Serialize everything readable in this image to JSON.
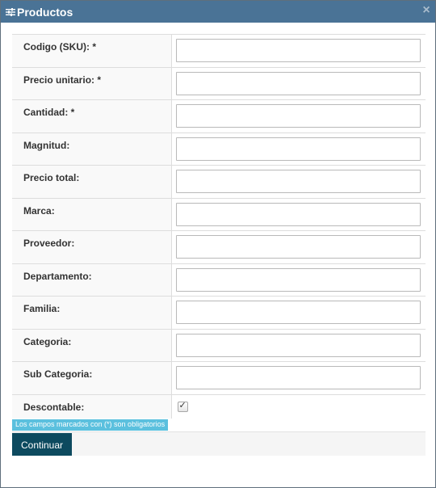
{
  "dialog": {
    "title": "Productos",
    "title_icon": "sliders-icon",
    "close_icon": "close-icon",
    "close_glyph": "×"
  },
  "form": {
    "fields": [
      {
        "label": "Codigo (SKU): *",
        "value": "",
        "required": true
      },
      {
        "label": "Precio unitario: *",
        "value": "",
        "required": true
      },
      {
        "label": "Cantidad: *",
        "value": "",
        "required": true
      },
      {
        "label": "Magnitud:",
        "value": ""
      },
      {
        "label": "Precio total:",
        "value": ""
      },
      {
        "label": "Marca:",
        "value": ""
      },
      {
        "label": "Proveedor:",
        "value": ""
      },
      {
        "label": "Departamento:",
        "value": ""
      },
      {
        "label": "Familia:",
        "value": ""
      },
      {
        "label": "Categoria:",
        "value": ""
      },
      {
        "label": "Sub Categoria:",
        "value": ""
      }
    ],
    "descontable": {
      "label": "Descontable:",
      "checked": true,
      "check_glyph": "✓"
    }
  },
  "note": {
    "required_text": "Los campos marcados con (*) son obligatorios"
  },
  "footer": {
    "continue_label": "Continuar"
  },
  "colors": {
    "titlebar": "#4a7396",
    "button": "#0d4a5f",
    "note_badge": "#5bc0de"
  }
}
